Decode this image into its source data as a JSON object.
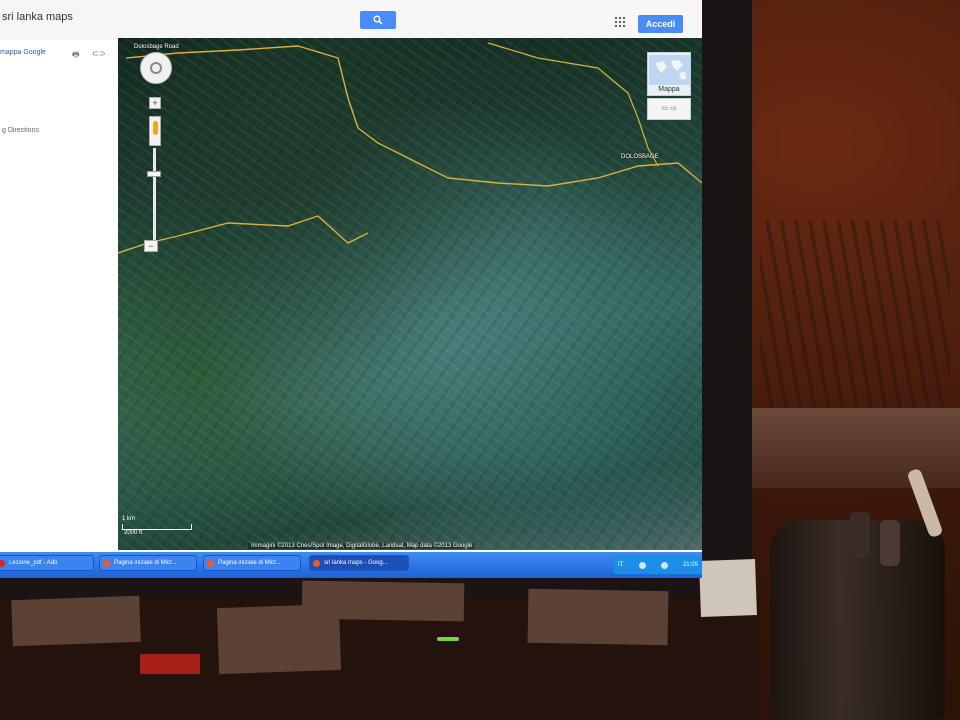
{
  "search": {
    "value": "sri lanka maps"
  },
  "header": {
    "accedi_label": "Accedi"
  },
  "leftpanel": {
    "link_text": "mappa Google",
    "directions_text": "g Directions"
  },
  "map": {
    "labels": [
      {
        "text": "Dolosbage Road"
      },
      {
        "text": "DOLOSBAGE"
      }
    ],
    "maptype_label": "Mappa",
    "scale": {
      "km": "1 km",
      "ft": "2000 ft"
    },
    "attribution": "Immagini ©2013 Cnes/Spot Image, DigitalGlobe, Landsat, Map data ©2013 Google"
  },
  "taskbar": {
    "buttons": [
      {
        "label": "Lezione_pdf - Ado"
      },
      {
        "label": "Pagina iniziale di Micr..."
      },
      {
        "label": "Pagina iniziale di Micr..."
      },
      {
        "label": "sri lanka maps - Goog..."
      }
    ],
    "tray": {
      "lang": "IT",
      "time": "21:05"
    }
  },
  "colors": {
    "accent": "#4a8cf7",
    "taskbar": "#2f7aed",
    "road": "#d8b23a"
  }
}
